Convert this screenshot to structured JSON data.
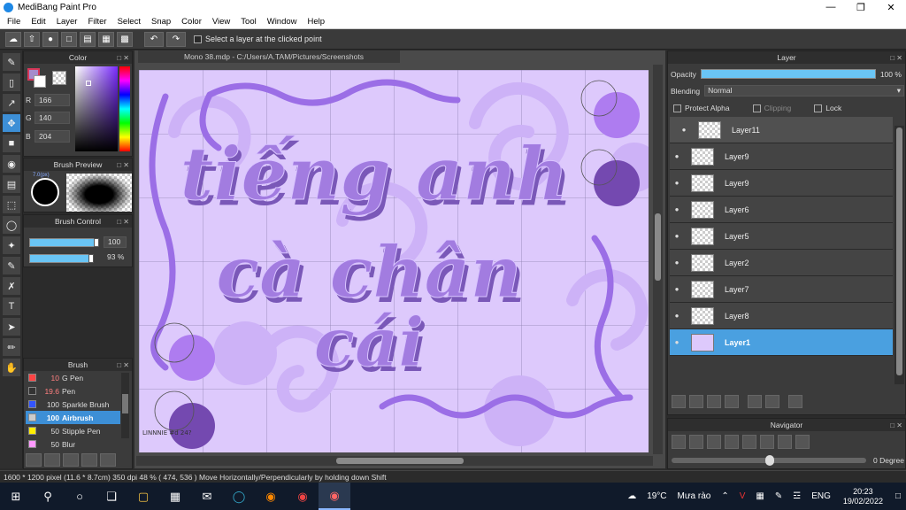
{
  "window": {
    "title": "MediBang Paint Pro"
  },
  "menu": [
    "File",
    "Edit",
    "Layer",
    "Filter",
    "Select",
    "Snap",
    "Color",
    "View",
    "Tool",
    "Window",
    "Help"
  ],
  "toolbar": {
    "select_layer_label": "Select a layer at the clicked point"
  },
  "document": {
    "tab_title": "Mono 38.mdp - C:/Users/A.TAM/Pictures/Screenshots"
  },
  "color_panel": {
    "title": "Color",
    "r_label": "R",
    "g_label": "G",
    "b_label": "B",
    "r": "166",
    "g": "140",
    "b": "204",
    "fg_color": "#a68ccc"
  },
  "brush_preview": {
    "title": "Brush Preview",
    "size_tag": "7.0(px)"
  },
  "brush_control": {
    "title": "Brush Control",
    "size_value": "100",
    "opacity_value": "93 %"
  },
  "brush_panel": {
    "title": "Brush",
    "items": [
      {
        "size": "10",
        "name": "G Pen",
        "color": "#ff4444"
      },
      {
        "size": "19.6",
        "name": "Pen",
        "color": "#333333"
      },
      {
        "size": "100",
        "name": "Sparkle Brush",
        "color": "#3355ff"
      },
      {
        "size": "100",
        "name": "Airbrush",
        "color": "#cccccc"
      },
      {
        "size": "50",
        "name": "Stipple Pen",
        "color": "#ffee00"
      },
      {
        "size": "50",
        "name": "Blur",
        "color": "#ff99ff"
      },
      {
        "size": "",
        "name": "",
        "color": "#ffee00"
      }
    ]
  },
  "canvas": {
    "words": [
      "tiếng anh",
      "cà chân",
      "cái"
    ],
    "signature": "LINNNIE\n#d 24?",
    "bg_color": "#ddc9fc",
    "text_color": "#a27ce0",
    "shadow_color": "#7a58b8"
  },
  "layer_panel": {
    "title": "Layer",
    "opacity_label": "Opacity",
    "opacity_value": "100 %",
    "blending_label": "Blending",
    "blending_value": "Normal",
    "protect_alpha": "Protect Alpha",
    "clipping": "Clipping",
    "lock": "Lock",
    "layers": [
      "Layer11",
      "Layer9",
      "Layer9",
      "Layer6",
      "Layer5",
      "Layer2",
      "Layer7",
      "Layer8",
      "Layer1"
    ]
  },
  "navigator": {
    "title": "Navigator",
    "rotation": "0 Degree"
  },
  "status": {
    "text": "1600 * 1200 pixel   (11.6 * 8.7cm)   350 dpi   48 %   ( 474, 536 )   Move Horizontally/Perpendicularly by holding down Shift"
  },
  "taskbar": {
    "weather_temp": "19°C",
    "weather_text": "Mưa rào",
    "lang": "ENG",
    "time": "20:23",
    "date": "19/02/2022"
  }
}
